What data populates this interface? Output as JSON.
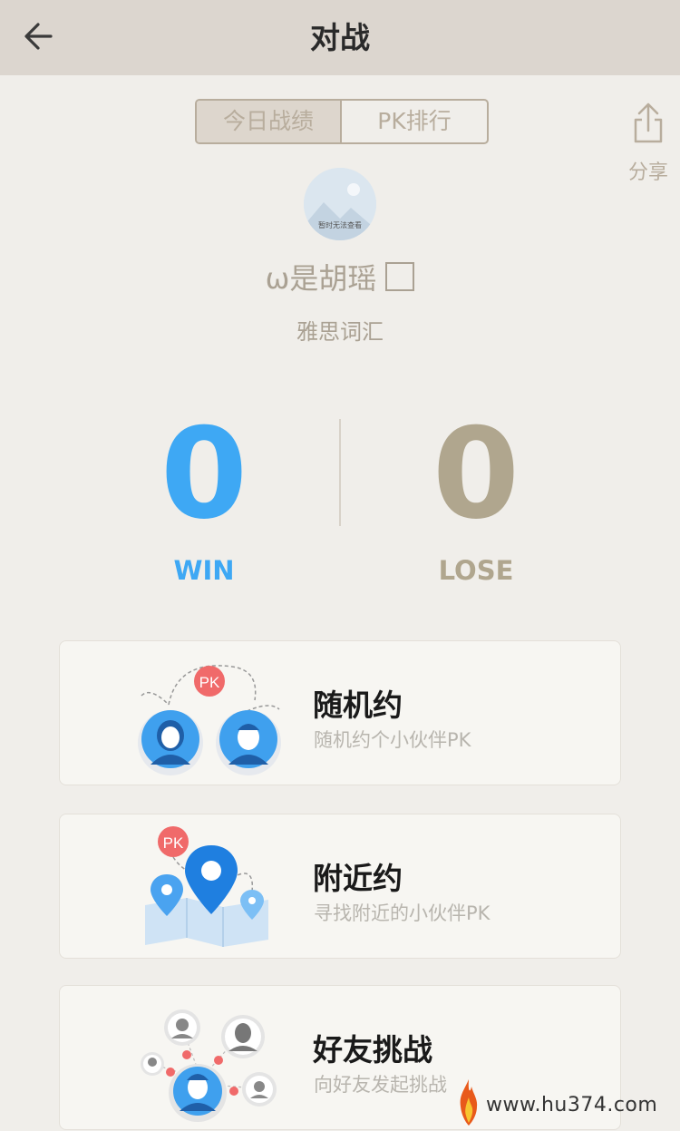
{
  "header": {
    "title": "对战",
    "back_icon": "arrow-left-icon"
  },
  "tabs": [
    {
      "label": "今日战绩",
      "active": true
    },
    {
      "label": "PK排行",
      "active": false
    }
  ],
  "share": {
    "label": "分享",
    "icon": "share-icon"
  },
  "profile": {
    "avatar_text": "暂时无法查看",
    "username": "ω是胡瑶",
    "subject": "雅思词汇"
  },
  "stats": {
    "win_value": "0",
    "win_label": "WIN",
    "lose_value": "0",
    "lose_label": "LOSE",
    "win_color": "#3ea8f4",
    "lose_color": "#b0a68e"
  },
  "modes": [
    {
      "title": "随机约",
      "subtitle": "随机约个小伙伴PK",
      "icon": "random-match-icon"
    },
    {
      "title": "附近约",
      "subtitle": "寻找附近的小伙伴PK",
      "icon": "nearby-map-icon"
    },
    {
      "title": "好友挑战",
      "subtitle": "向好友发起挑战",
      "icon": "friends-challenge-icon"
    }
  ],
  "illustration_badge": "PK",
  "watermark": {
    "text": "www.hu374.com"
  }
}
